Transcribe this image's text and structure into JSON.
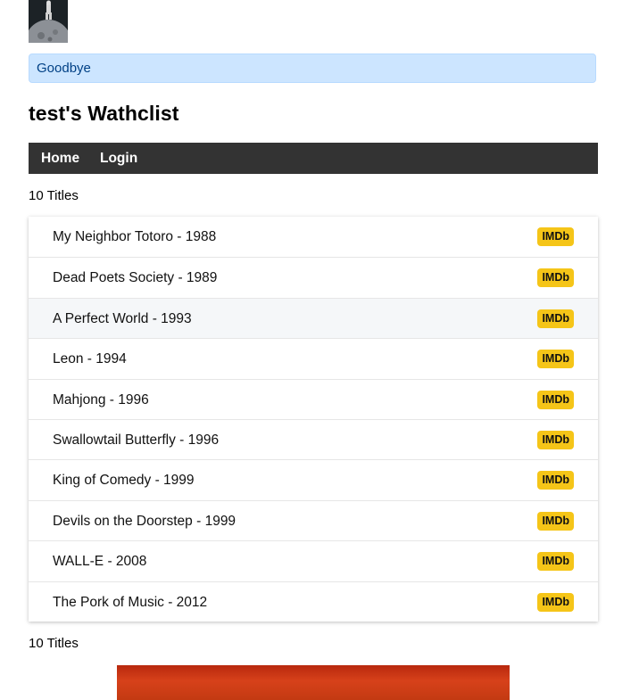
{
  "flash": {
    "message": "Goodbye"
  },
  "page_title": "test's Wathclist",
  "nav": {
    "home_label": "Home",
    "login_label": "Login"
  },
  "titles_count": "10 Titles",
  "badge_label": "IMDb",
  "colors": {
    "nav_bg": "#333333",
    "flash_bg": "#cce5ff",
    "flash_text": "#004085",
    "imdb_badge": "#f5c518"
  },
  "movies": [
    {
      "label": "My Neighbor Totoro - 1988"
    },
    {
      "label": "Dead Poets Society - 1989"
    },
    {
      "label": "A Perfect World - 1993"
    },
    {
      "label": "Leon - 1994"
    },
    {
      "label": "Mahjong - 1996"
    },
    {
      "label": "Swallowtail Butterfly - 1996"
    },
    {
      "label": "King of Comedy - 1999"
    },
    {
      "label": "Devils on the Doorstep - 1999"
    },
    {
      "label": "WALL-E - 2008"
    },
    {
      "label": "The Pork of Music - 2012"
    }
  ]
}
